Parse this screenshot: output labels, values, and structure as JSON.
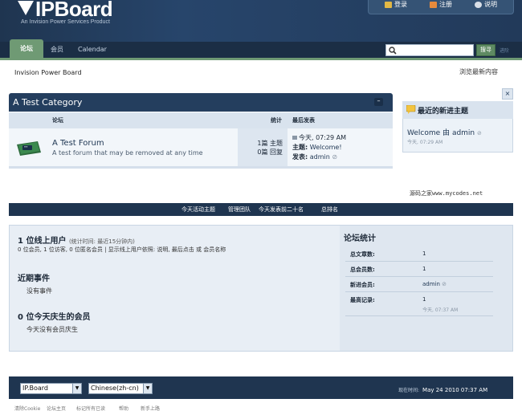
{
  "header": {
    "logo": "IPBoard",
    "tagline": "An Invision Power Services Product",
    "userbar": [
      {
        "icon": "key-icon",
        "label": "登录"
      },
      {
        "icon": "register-icon",
        "label": "注册"
      },
      {
        "icon": "help-icon",
        "label": "说明"
      }
    ]
  },
  "nav": {
    "tabs": [
      "论坛",
      "会员",
      "Calendar"
    ],
    "search_button": "搜寻",
    "search_advanced": "进阶"
  },
  "breadcrumb": "Invision Power Board",
  "view_new": "浏览最新内容",
  "category": {
    "title": "A Test Category",
    "collapse": "–",
    "columns": {
      "forum": "论坛",
      "stats": "统计",
      "last": "最后发表"
    },
    "forum": {
      "name": "A Test Forum",
      "description": "A test forum that may be removed at any time",
      "topics": "1篇 主题",
      "replies": "0篇 回复",
      "last_date": "今天, 07:29 AM",
      "last_topic_label": "主题:",
      "last_topic": "Welcome!",
      "last_by_label": "发表:",
      "last_by": "admin"
    }
  },
  "recent": {
    "close": "×",
    "title": "最近的新进主题",
    "item_title": "Welcome",
    "item_by": "由",
    "item_author": "admin",
    "item_date": "今天, 07:29 AM"
  },
  "credit": "源码之家www.mycodes.net",
  "stats_bar": [
    "今天活动主题",
    "管理团队",
    "今天发表前二十名",
    "总排名"
  ],
  "board_stats": {
    "online_title": "1 位线上用户",
    "online_note": "(统计时间: 最近15分钟内)",
    "online_detail": "0 位会员, 1 位访客, 0 位匿名会员 | 显示线上用户依照: 说明, 最后点击 或 会员名称",
    "events_title": "近期事件",
    "events_text": "没有事件",
    "bday_title": "0 位今天庆生的会员",
    "bday_text": "今天没有会员庆生",
    "forum_stats_title": "论坛统计",
    "rows": [
      {
        "k": "总文章数:",
        "v": "1"
      },
      {
        "k": "总会员数:",
        "v": "1"
      },
      {
        "k": "新进会员:",
        "v": "admin"
      },
      {
        "k": "最高记录:",
        "v": "1"
      }
    ],
    "record_date": "今天, 07:37 AM"
  },
  "footer": {
    "skin": "IP.Board",
    "lang": "Chinese(zh-cn)",
    "time_label": "现在时间:",
    "time": "May 24 2010 07:37 AM",
    "links": [
      "清除Cookie",
      "论坛主页",
      "标记所有已读",
      "帮助",
      "新手上路"
    ]
  },
  "colors": {
    "accent_green": "#6f9a74",
    "header_navy": "#1f3550"
  }
}
